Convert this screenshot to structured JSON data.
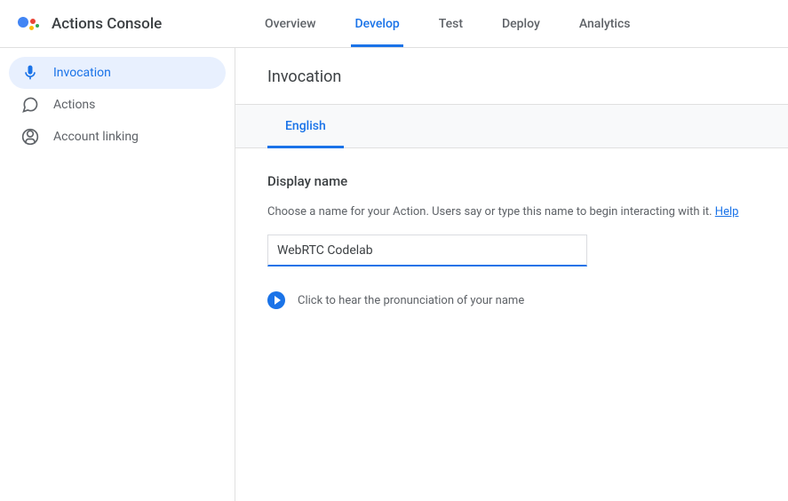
{
  "header": {
    "app_title": "Actions Console",
    "tabs": [
      {
        "label": "Overview",
        "active": false
      },
      {
        "label": "Develop",
        "active": true
      },
      {
        "label": "Test",
        "active": false
      },
      {
        "label": "Deploy",
        "active": false
      },
      {
        "label": "Analytics",
        "active": false
      }
    ]
  },
  "sidebar": {
    "items": [
      {
        "label": "Invocation",
        "icon": "mic-icon",
        "selected": true
      },
      {
        "label": "Actions",
        "icon": "chat-icon",
        "selected": false
      },
      {
        "label": "Account linking",
        "icon": "account-icon",
        "selected": false
      }
    ]
  },
  "main": {
    "page_title": "Invocation",
    "lang_tabs": [
      {
        "label": "English",
        "active": true
      }
    ],
    "display_name": {
      "title": "Display name",
      "description": "Choose a name for your Action. Users say or type this name to begin interacting with it. ",
      "help_label": "Help",
      "input_value": "WebRTC Codelab",
      "play_label": "Click to hear the pronunciation of your name"
    }
  }
}
